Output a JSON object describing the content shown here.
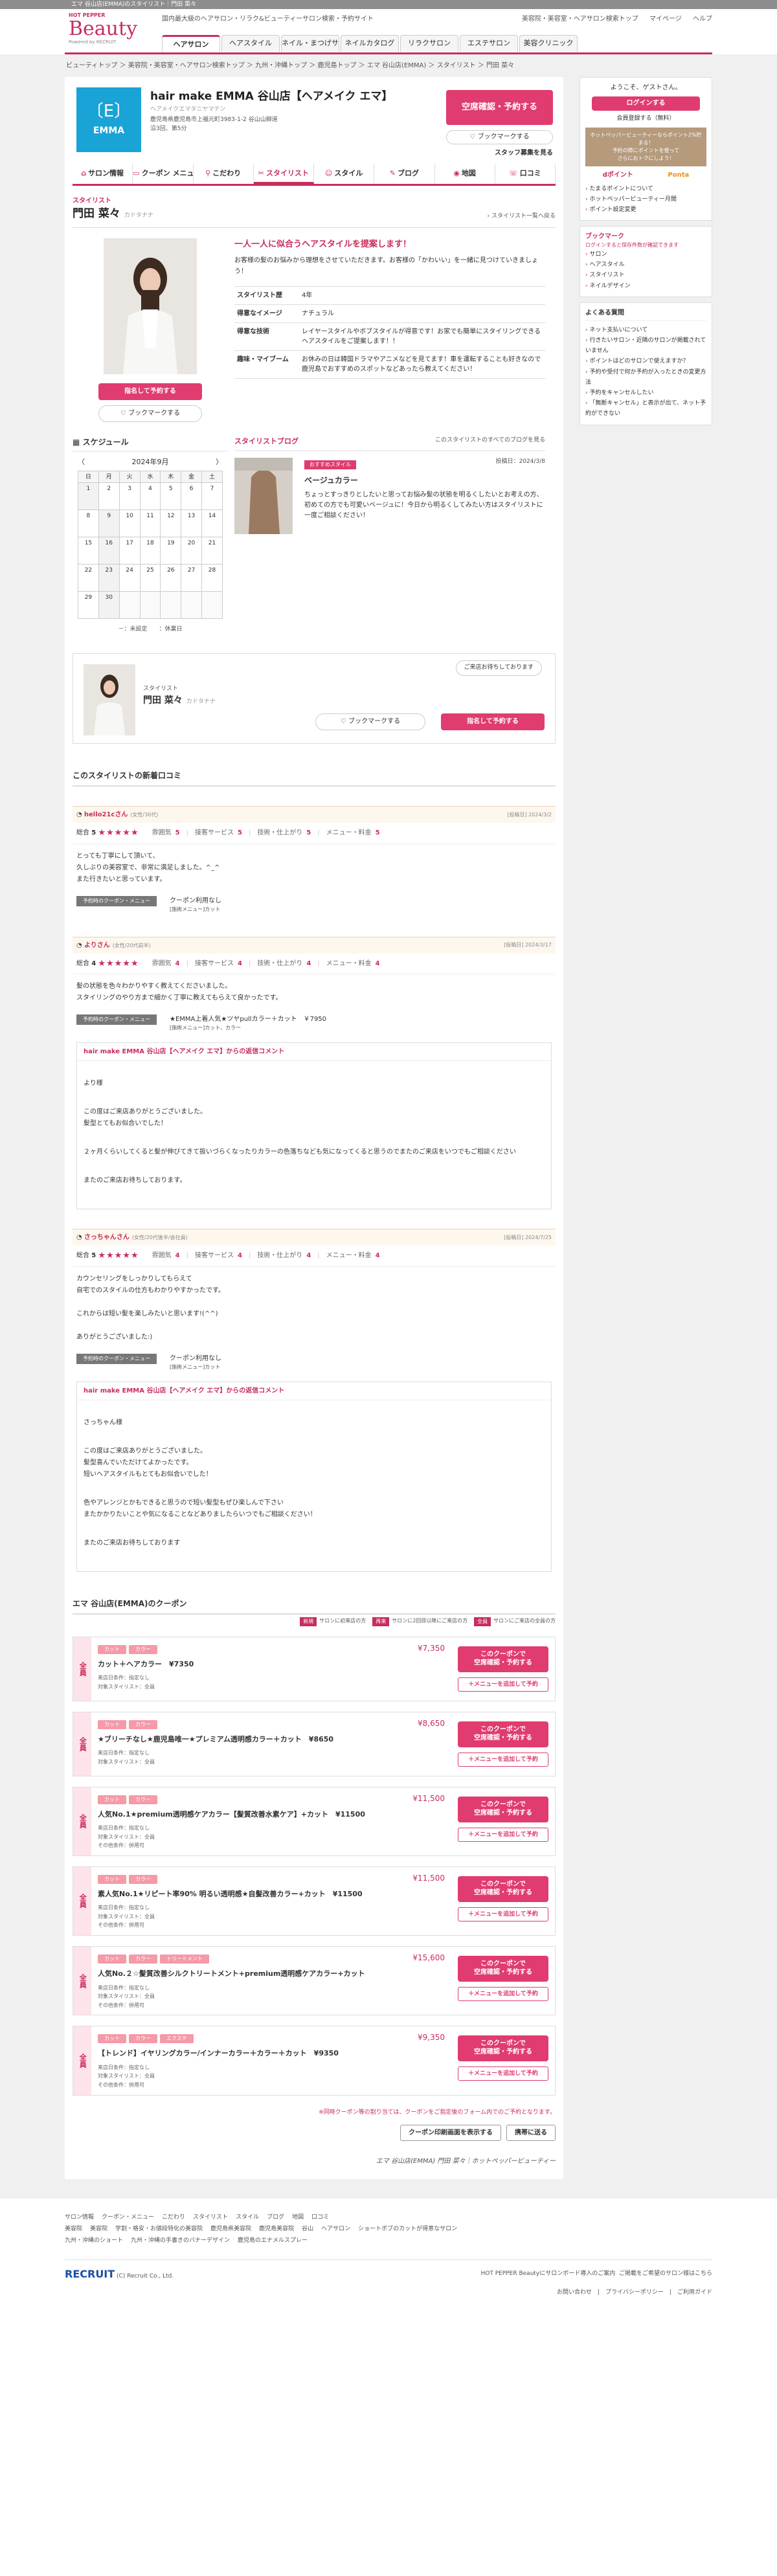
{
  "topbar": "エマ 谷山店(EMMA)のスタイリスト｜門田 菜々",
  "header": {
    "logo_hp": "HOT PEPPER",
    "logo_beauty": "Beauty",
    "logo_powered": "Powered by RECRUIT",
    "tagline": "国内最大級のヘアサロン・リラク&ビューティーサロン検索・予約サイト",
    "links": [
      "美容院・美容室・ヘアサロン検索トップ",
      "マイページ",
      "ヘルプ"
    ],
    "nav": [
      "ヘアサロン",
      "ヘアスタイル",
      "ネイル・まつげサロン",
      "ネイルカタログ",
      "リラクサロン",
      "エステサロン",
      "美容クリニック"
    ]
  },
  "breadcrumb": "ビューティトップ ＞ 美容院・美容室・ヘアサロン検索トップ ＞ 九州・沖縄トップ ＞ 鹿児島トップ ＞ エマ 谷山店(EMMA) ＞ スタイリスト ＞ 門田 菜々",
  "salon": {
    "logo_top": "〔E〕",
    "logo_text": "EMMA",
    "name": "hair make EMMA 谷山店【ヘアメイク エマ】",
    "kana": "ヘアメイクエマタニヤマテン",
    "address": "鹿児島県鹿児島市上福元町3983-1-2 \n谷山山脚道沿3回、第5分",
    "reserve_btn": "空席確認・予約する",
    "bookmark_btn": "ブックマークする",
    "jobs": "スタッフ募集を見る"
  },
  "tabs": [
    "サロン情報",
    "クーポン メニュー",
    "こだわり",
    "スタイリスト",
    "スタイル",
    "ブログ",
    "地図",
    "口コミ"
  ],
  "stylist": {
    "label": "スタイリスト",
    "name": "門田 菜々",
    "kana": "カドタナナ",
    "to_list": "スタイリスト一覧へ戻る",
    "reserve": "指名して予約する",
    "bookmark": "ブックマークする",
    "catch": "一人一人に似合うヘアスタイルを提案します！",
    "intro": "お客様の髪のお悩みから理想をさせていただきます。お客様の「かわいい」を一緒に見つけていきましょう！",
    "profile": [
      {
        "k": "スタイリスト歴",
        "v": "4年"
      },
      {
        "k": "得意なイメージ",
        "v": "ナチュラル"
      },
      {
        "k": "得意な技術",
        "v": "レイヤースタイルやボブスタイルが得意です！お家でも簡単にスタイリングできるヘアスタイルをご提案します！！"
      },
      {
        "k": "趣味・マイブーム",
        "v": "お休みの日は韓国ドラマやアニメなどを見てます！車を運転することも好きなので鹿児島でおすすめのスポットなどあったら教えてください！"
      }
    ]
  },
  "calendar": {
    "title": "スケジュール",
    "month": "2024年9月",
    "prev": "〈",
    "next": "〉",
    "weekdays": [
      "日",
      "月",
      "火",
      "水",
      "木",
      "金",
      "土"
    ],
    "weeks": [
      [
        "1",
        "2",
        "3",
        "4",
        "5",
        "6",
        "7"
      ],
      [
        "8",
        "9",
        "10",
        "11",
        "12",
        "13",
        "14"
      ],
      [
        "15",
        "16",
        "17",
        "18",
        "19",
        "20",
        "21"
      ],
      [
        "22",
        "23",
        "24",
        "25",
        "26",
        "27",
        "28"
      ],
      [
        "29",
        "30",
        "",
        "",
        "",
        "",
        ""
      ]
    ],
    "legend": "－：未設定　　：休業日"
  },
  "blog": {
    "title": "スタイリストブログ",
    "more": "このスタイリストのすべてのブログを見る",
    "tag": "おすすめスタイル",
    "date": "投稿日：2024/3/8",
    "post_title": "ベージュカラー",
    "excerpt": "ちょっとすっきりとしたいと思ってお悩み髪の状態を明るくしたいとお考えの方、初めての方でも可愛いベージュに！今日から明るくしてみたい方はスタイリストに一度ご相談ください！"
  },
  "mini": {
    "label": "スタイリスト",
    "name": "門田 菜々",
    "kana": "カドタナナ",
    "bubble": "ご来店お待ちしております",
    "bookmark": "ブックマークする",
    "reserve": "指名して予約する"
  },
  "reviews_title": "このスタイリストの新着口コミ",
  "reviews": [
    {
      "user": "hello21cさん",
      "meta": "(女性/30代)",
      "date": "[投稿日] 2024/3/2",
      "overall_label": "総合",
      "overall": "5",
      "stars": "★★★★★",
      "scores": [
        {
          "l": "雰囲気",
          "v": "5"
        },
        {
          "l": "接客サービス",
          "v": "5"
        },
        {
          "l": "技術・仕上がり",
          "v": "5"
        },
        {
          "l": "メニュー・料金",
          "v": "5"
        }
      ],
      "body": "とっても丁寧にして頂いて、\n久しぶりの美容室で、非常に満足しました。^_^\nまた行きたいと思っています。",
      "menu_tag": "予約時のクーポン・メニュー",
      "menu": "クーポン利用なし",
      "menu_sub": "[施術メニュー]カット",
      "reply": null
    },
    {
      "user": "よりさん",
      "meta": "(女性/20代前半)",
      "date": "[投稿日] 2024/3/17",
      "overall_label": "総合",
      "overall": "4",
      "stars": "★★★★★",
      "scores": [
        {
          "l": "雰囲気",
          "v": "4"
        },
        {
          "l": "接客サービス",
          "v": "4"
        },
        {
          "l": "技術・仕上がり",
          "v": "4"
        },
        {
          "l": "メニュー・料金",
          "v": "4"
        }
      ],
      "body": "髪の状態を色々わかりやすく教えてくださいました。\nスタイリングのやり方まで細かく丁寧に教えてもらえて良かったです。",
      "menu_tag": "予約時のクーポン・メニュー",
      "menu": "★EMMA上着人気★ツヤpullカラー＋カット　￥7950",
      "menu_sub": "[施術メニュー]カット、カラー",
      "reply": {
        "head": "hair make EMMA 谷山店【ヘアメイク エマ】からの返信コメント",
        "lines": [
          "より様",
          "この度はご来店ありがとうございました。\n髪型とてもお似合いでした！",
          "２ヶ月くらいしてくると髪が伸びてきて扱いづらくなったりカラーの色落ちなども気になってくると思うのでまたのご来店をいつでもご相談ください",
          "またのご来店お待ちしております。"
        ]
      }
    },
    {
      "user": "さっちゃんさん",
      "meta": "(女性/20代後半/会社員)",
      "date": "[投稿日] 2024/7/25",
      "overall_label": "総合",
      "overall": "5",
      "stars": "★★★★★",
      "scores": [
        {
          "l": "雰囲気",
          "v": "4"
        },
        {
          "l": "接客サービス",
          "v": "4"
        },
        {
          "l": "技術・仕上がり",
          "v": "4"
        },
        {
          "l": "メニュー・料金",
          "v": "4"
        }
      ],
      "body": "カウンセリングをしっかりしてもらえて\n自宅でのスタイルの仕方もわかりやすかったです。\n\nこれからは短い髪を楽しみたいと思います!(^^)\n\nありがとうございました:)",
      "menu_tag": "予約時のクーポン・メニュー",
      "menu": "クーポン利用なし",
      "menu_sub": "[施術メニュー]カット",
      "reply": {
        "head": "hair make EMMA 谷山店【ヘアメイク エマ】からの返信コメント",
        "lines": [
          "さっちゃん様",
          "この度はご来店ありがとうございました。\n髪型喜んでいただけてよかったです。\n短いヘアスタイルもとてもお似合いでした！",
          "色やアレンジとかもできると思うので短い髪型もぜひ楽しんで下さい\nまたかかりたいことや気になることなどありましたらいつでもご相談ください！",
          "またのご来店お待ちしております"
        ]
      }
    }
  ],
  "coupons_title": "エマ 谷山店(EMMA)のクーポン",
  "coupon_legend": [
    {
      "lg": "新規",
      "t": "サロンに初来店の方"
    },
    {
      "lg": "再来",
      "t": "サロンに2回目以降にご来店の方"
    },
    {
      "lg": "全員",
      "t": "サロンにご来店の全員の方"
    }
  ],
  "coupons": [
    {
      "side": "全員",
      "cats": [
        "カット",
        "カラー"
      ],
      "price": "¥7,350",
      "name": "カット＋ヘアカラー　¥7350",
      "info": [
        "来店日条件：指定なし",
        "対象スタイリスト：全員"
      ]
    },
    {
      "side": "全員",
      "cats": [
        "カット",
        "カラー"
      ],
      "price": "¥8,650",
      "name": "★ブリーチなし★鹿児島唯一★プレミアム透明感カラー＋カット　¥8650",
      "info": [
        "来店日条件：指定なし",
        "対象スタイリスト：全員"
      ]
    },
    {
      "side": "全員",
      "cats": [
        "カット",
        "カラー"
      ],
      "price": "¥11,500",
      "name": "人気No.1★premium透明感ケアカラー【髪質改善水素ケア】+カット　¥11500",
      "info": [
        "来店日条件：指定なし",
        "対象スタイリスト：全員",
        "その他条件：併用可"
      ]
    },
    {
      "side": "全員",
      "cats": [
        "カット",
        "カラー"
      ],
      "price": "¥11,500",
      "name": "素人気No.1★リピート率90% 明るい透明感★自髪改善カラー+カット　¥11500",
      "info": [
        "来店日条件：指定なし",
        "対象スタイリスト：全員",
        "その他条件：併用可"
      ]
    },
    {
      "side": "全員",
      "cats": [
        "カット",
        "カラー",
        "トリートメント"
      ],
      "price": "¥15,600",
      "name": "人気No.２☆髪質改善シルクトリートメント+premium透明感ケアカラー+カット",
      "info": [
        "来店日条件：指定なし",
        "対象スタイリスト：全員",
        "その他条件：併用可"
      ]
    },
    {
      "side": "全員",
      "cats": [
        "カット",
        "カラー",
        "エクステ"
      ],
      "price": "¥9,350",
      "name": "【トレンド】イヤリングカラー/インナーカラー＋カラー＋カット　¥9350",
      "info": [
        "来店日条件：指定なし",
        "対象スタイリスト：全員",
        "その他条件：併用可"
      ]
    }
  ],
  "coupon_btn1": "このクーポンで\n空席確認・予約する",
  "coupon_btn2": "＋メニューを追加して予約",
  "coupon_note": "※同時クーポン等の割り当ては、クーポンをご指定後のフォーム内でのご予約となります。",
  "coupon_actions": [
    "クーポン印刷画面を表示する",
    "携帯に送る"
  ],
  "page_footer_crumb": "エマ 谷山店(EMMA) 門田 菜々｜ホットペッパービューティー",
  "sidebar": {
    "greet": "ようこそ、ゲストさん。",
    "login": "ログインする",
    "register": "会員登録する（無料）",
    "pt_text": "ホットペッパービューティーならポイント2%貯まる！\n予約の際にポイントを使って\nさらにおトクにしよう！",
    "pt_logos": [
      "dポイント",
      "Ponta"
    ],
    "pt_links": [
      "たまるポイントについて",
      "ホットペッパービューティー月間",
      "ポイント設定変更"
    ],
    "bm_title": "ブックマーク",
    "bm_note": "ログインすると保存件数が確認できます",
    "bm_links": [
      "サロン",
      "ヘアスタイル",
      "スタイリスト",
      "ネイルデザイン"
    ],
    "faq_title": "よくある質問",
    "faq": [
      "ネット支払いについて",
      "行きたいサロン・近隣のサロンが掲載されていません",
      "ポイントはどのサロンで使えますか？",
      "予約や受付で何か予約が入ったときの変更方法",
      "予約をキャンセルしたい",
      "「無断キャンセル」と表示が出て、ネット予約ができない"
    ]
  },
  "footer": {
    "row1": [
      "サロン情報",
      "クーポン・メニュー",
      "こだわり",
      "スタイリスト",
      "スタイル",
      "ブログ",
      "地図",
      "口コミ"
    ],
    "row2": [
      "美容院",
      "美容院",
      "学割・格安・お値段特化の美容院",
      "鹿児島県美容院",
      "鹿児島美容院",
      "谷山",
      "ヘアサロン",
      "ショートボブのカットが得意なサロン"
    ],
    "row3": [
      "九州・沖縄のショート",
      "九州・沖縄の手書きのバナーデザイン",
      "鹿児島のエナメルスプレー"
    ],
    "corp": "(C) Recruit Co., Ltd.",
    "recruit": "RECRUIT",
    "biz": "HOT PEPPER Beautyにサロンボード導入のご案内",
    "misc": [
      "ご掲載をご希望のサロン様はこちら",
      "お問い合わせ",
      "プライバシーポリシー",
      "ご利用ガイド"
    ]
  }
}
